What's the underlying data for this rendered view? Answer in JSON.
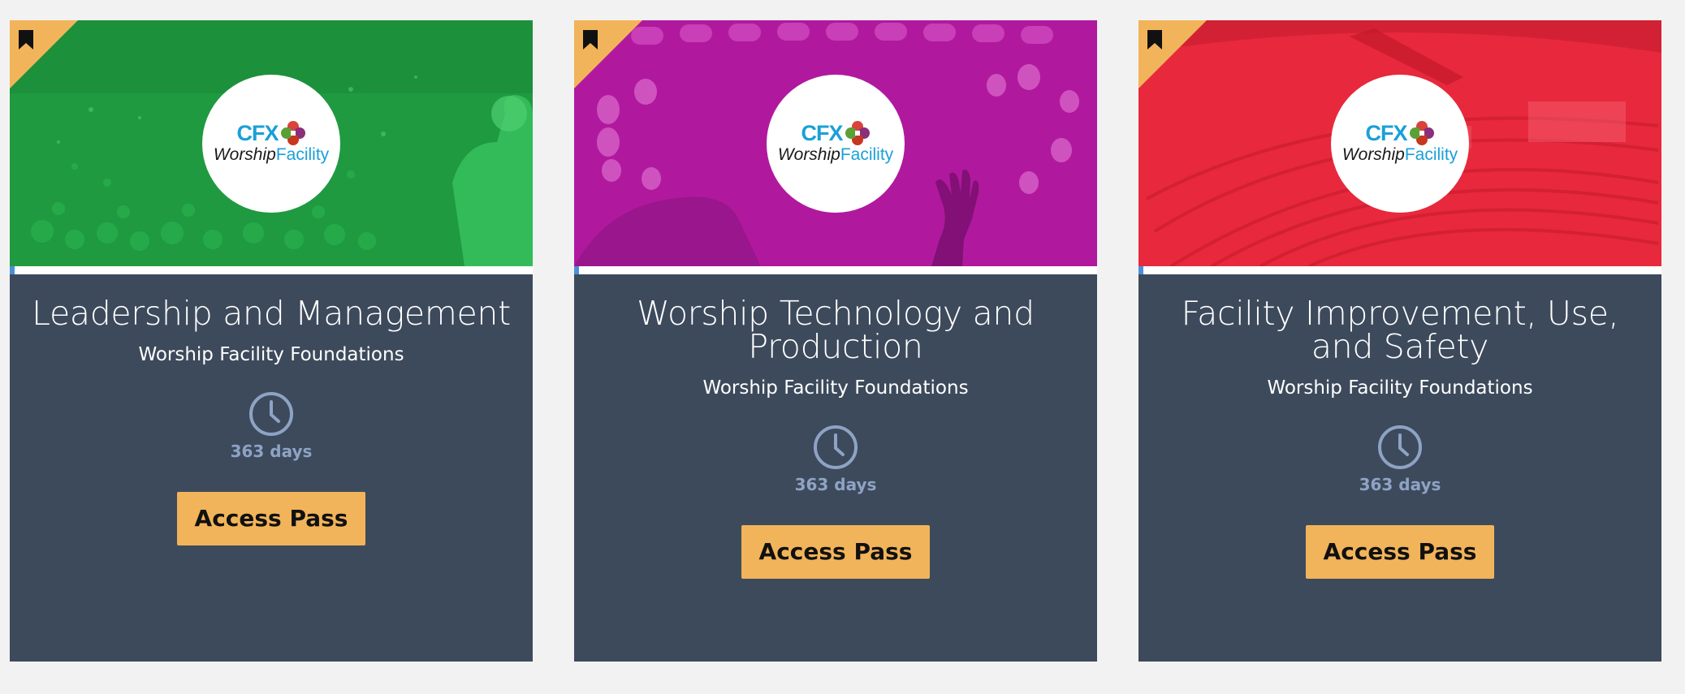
{
  "logo": {
    "cfx": "CFX",
    "worship": "Worship",
    "facility": "Facility"
  },
  "cards": [
    {
      "title": "Leadership and Management",
      "subtitle": "Worship Facility Foundations",
      "duration": "363 days",
      "button": "Access Pass",
      "banner_color": "#1f9a40",
      "banner_theme": "green",
      "progress_fraction": 0.01
    },
    {
      "title": "Worship Technology and Production",
      "subtitle": "Worship Facility Foundations",
      "duration": "363 days",
      "button": "Access Pass",
      "banner_color": "#b0199e",
      "banner_theme": "magenta",
      "progress_fraction": 0.01
    },
    {
      "title": "Facility Improvement, Use, and Safety",
      "subtitle": "Worship Facility Foundations",
      "duration": "363 days",
      "button": "Access Pass",
      "banner_color": "#e8283c",
      "banner_theme": "red",
      "progress_fraction": 0.01
    }
  ],
  "colors": {
    "accent": "#f2b45a",
    "card_bg": "#3d4a5c",
    "duration_text": "#8ea3c4",
    "cfx_blue": "#1aa0d8"
  }
}
